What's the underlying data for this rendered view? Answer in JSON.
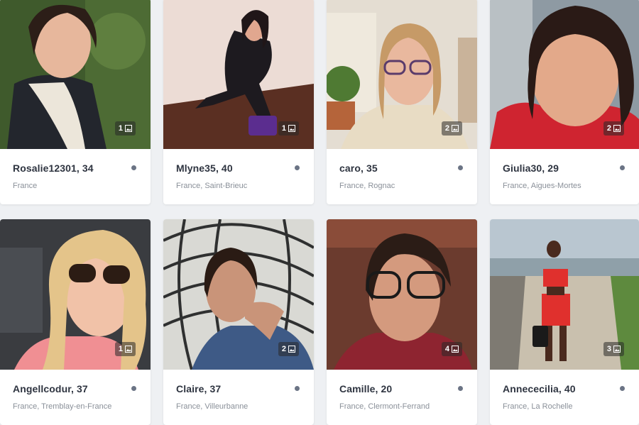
{
  "profiles": [
    {
      "name_age": "Rosalie12301, 34",
      "location": "France",
      "photo_count": "1"
    },
    {
      "name_age": "Mlyne35, 40",
      "location": "France, Saint-Brieuc",
      "photo_count": "1"
    },
    {
      "name_age": "caro, 35",
      "location": "France, Rognac",
      "photo_count": "2"
    },
    {
      "name_age": "Giulia30, 29",
      "location": "France, Aigues-Mortes",
      "photo_count": "2"
    },
    {
      "name_age": "Angellcodur, 37",
      "location": "France, Tremblay-en-France",
      "photo_count": "1"
    },
    {
      "name_age": "Claire, 37",
      "location": "France, Villeurbanne",
      "photo_count": "2"
    },
    {
      "name_age": "Camille, 20",
      "location": "France, Clermont-Ferrand",
      "photo_count": "4"
    },
    {
      "name_age": "Annececilia, 40",
      "location": "France, La Rochelle",
      "photo_count": "3"
    }
  ],
  "icons": {
    "photo_count_icon": "image-icon",
    "status_icon": "status-dot-icon"
  },
  "colors": {
    "background": "#eef0f3",
    "card": "#ffffff",
    "name_text": "#2e3440",
    "location_text": "#8a9099",
    "status_dot": "#6b7485"
  }
}
